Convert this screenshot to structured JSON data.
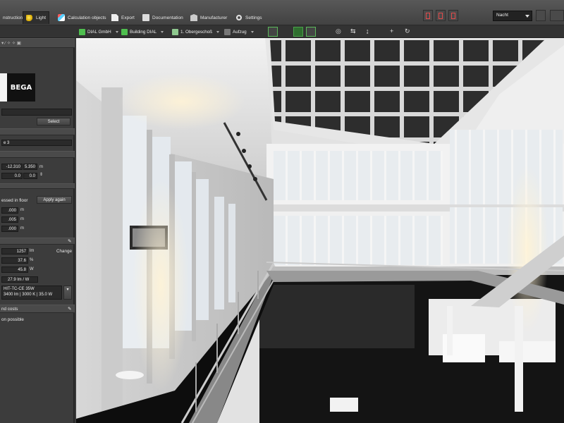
{
  "menubar": {
    "tabs": [
      {
        "label": "nstruction",
        "icon": "construction-icon"
      },
      {
        "label": "Light",
        "icon": "light-bulb-icon"
      },
      {
        "label": "Calculation objects",
        "icon": "calculation-objects-icon"
      },
      {
        "label": "Export",
        "icon": "export-icon"
      },
      {
        "label": "Documentation",
        "icon": "documentation-icon"
      },
      {
        "label": "Manufacturer",
        "icon": "manufacturer-icon"
      },
      {
        "label": "Settings",
        "icon": "settings-icon"
      }
    ],
    "view_mode": "Nacht"
  },
  "toolbar": {
    "company": "DIAL GmbH",
    "building": "Building DIAL",
    "floor": "1. Obergeschoß",
    "room": "Aufzug"
  },
  "left_panel": {
    "manufacturer_logo_text": "BEGA",
    "select_label": "Select",
    "luminaire_name": "e 3",
    "position_x": "-12.310",
    "position_y": "5.350",
    "position_unit": "m",
    "rotation_1": "0.0",
    "rotation_2": "0.0",
    "recessed_label": "essed in floor",
    "apply_again_label": "Apply again",
    "dims": [
      ".000",
      ".005",
      ".000"
    ],
    "dims_unit": "m",
    "luminous_flux": "1257",
    "luminous_flux_unit": "lm",
    "change_label": "Change",
    "efficiency": "37.6",
    "efficiency_unit": "%",
    "power": "45.8",
    "power_unit": "W",
    "efficacy": "27.9 lm / W",
    "lamp_type": "HIT-TC-CE  35W",
    "lamp_spec": "3400 lm | 3000 K | 35.0 W",
    "costs_header": "nd costs",
    "costs_status": "on possible"
  },
  "colors": {
    "accent_green": "#4fbf4f",
    "panel_bg": "#3c3c3c",
    "menubar_bg": "#4a4a4a"
  }
}
